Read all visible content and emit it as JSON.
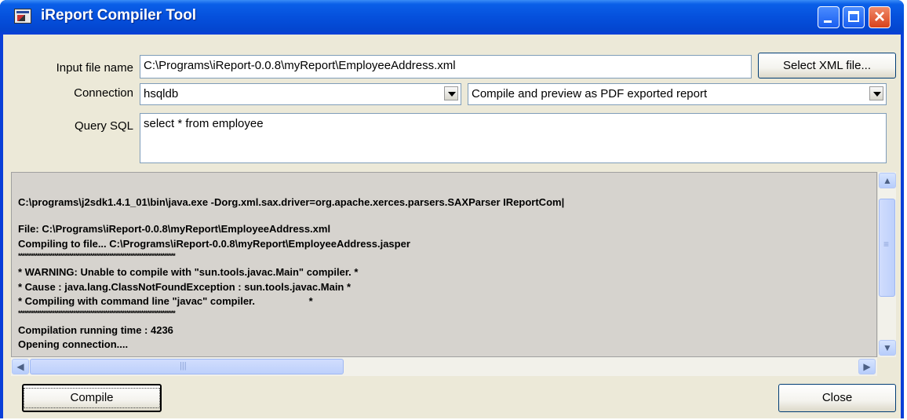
{
  "window": {
    "title": "iReport Compiler Tool"
  },
  "form": {
    "input_label": "Input file name",
    "input_value": "C:\\Programs\\iReport-0.0.8\\myReport\\EmployeeAddress.xml",
    "select_button": "Select XML file...",
    "connection_label": "Connection",
    "connection_value": "hsqldb",
    "mode_value": "Compile and  preview as PDF exported report",
    "query_label": "Query SQL",
    "query_value": "select * from employee"
  },
  "log": {
    "lines": [
      "C:\\programs\\j2sdk1.4.1_01\\bin\\java.exe -Dorg.xml.sax.driver=org.apache.xerces.parsers.SAXParser IReportCom|",
      "",
      "File:  C:\\Programs\\iReport-0.0.8\\myReport\\EmployeeAddress.xml",
      "Compiling to file... C:\\Programs\\iReport-0.0.8\\myReport\\EmployeeAddress.jasper",
      "**************************************************************************",
      "* WARNING: Unable to compile with \"sun.tools.javac.Main\" compiler. *",
      "* Cause  : java.lang.ClassNotFoundException : sun.tools.javac.Main *",
      "* Compiling with command line \"javac\" compiler.                   *",
      "**************************************************************************",
      "Compilation running time : 4236",
      "Opening connection...."
    ]
  },
  "buttons": {
    "compile": "Compile",
    "close": "Close"
  },
  "colors": {
    "titlebar": "#0550dc",
    "client": "#ece9d8",
    "log_bg": "#d6d3ce",
    "close_btn": "#d8421a"
  }
}
